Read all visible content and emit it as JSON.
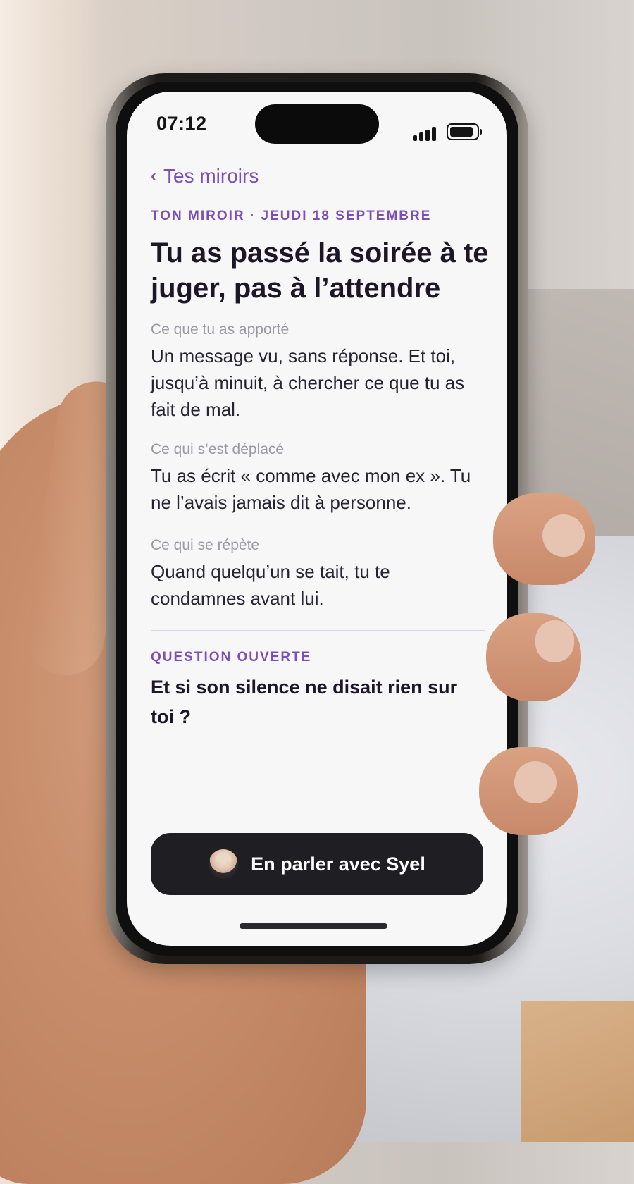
{
  "status_bar": {
    "time": "07:12",
    "signal_icon": "cellular-signal-icon",
    "battery_icon": "battery-icon"
  },
  "nav": {
    "back_icon": "chevron-left-icon",
    "back_label": "Tes miroirs"
  },
  "header": {
    "eyebrow": "TON MIROIR · JEUDI 18 SEPTEMBRE",
    "title": "Tu as passé la soirée à te juger, pas à l’attendre"
  },
  "sections": [
    {
      "label": "Ce que tu as apporté",
      "body": "Un message vu, sans réponse. Et toi, jusqu’à minuit, à chercher ce que tu as fait de mal."
    },
    {
      "label": "Ce qui s’est déplacé",
      "body": "Tu as écrit « comme avec mon ex ». Tu ne l’avais jamais dit à personne."
    },
    {
      "label": "Ce qui se répète",
      "body": "Quand quelqu’un se tait, tu te condamnes avant lui."
    }
  ],
  "open_question": {
    "label": "QUESTION OUVERTE",
    "text": "Et si son silence ne disait rien sur toi ?"
  },
  "cta": {
    "avatar_icon": "syel-avatar",
    "label": "En parler avec Syel"
  },
  "colors": {
    "accent": "#7a4fb8",
    "screen_bg": "#f7f7f8",
    "cta_bg": "#1f1e23",
    "title": "#1c1727",
    "muted": "#9b98a2"
  }
}
